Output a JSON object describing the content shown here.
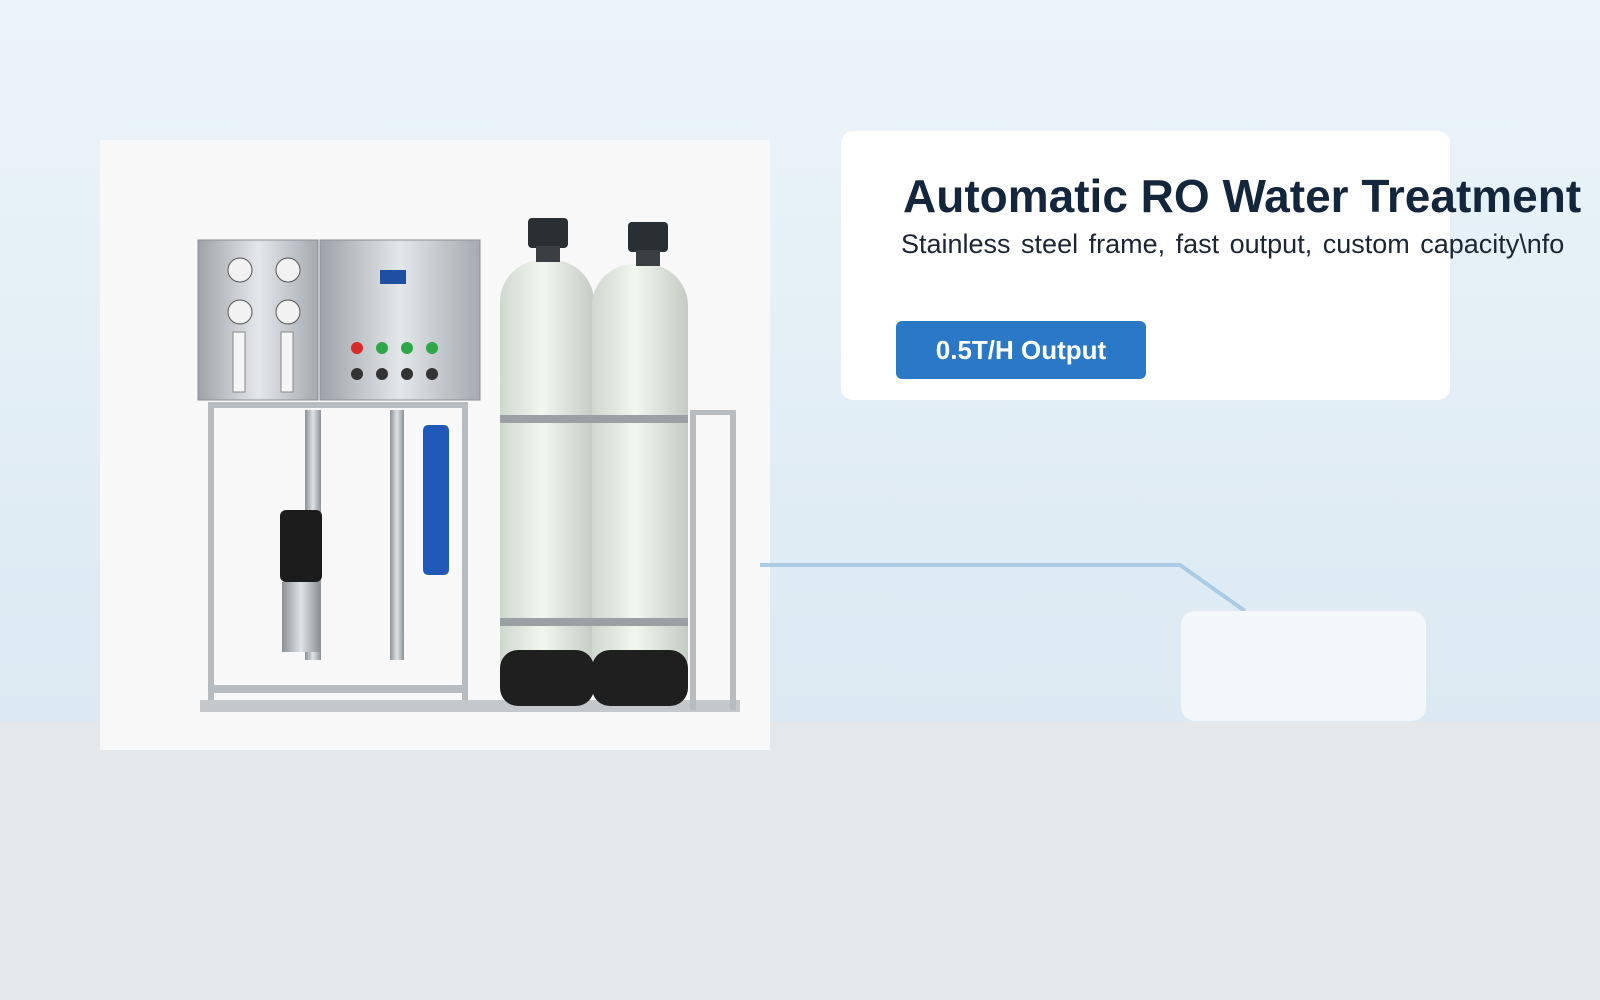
{
  "product": {
    "title": "Automatic RO Water Treatment",
    "subtitle": "Stainless steel frame, fast output, custom capacity\\nfo",
    "badge_label": "0.5T/H Output"
  },
  "colors": {
    "badge_bg": "#2a78c6",
    "title_text": "#14263b",
    "connector_line": "#a9cbe6"
  }
}
